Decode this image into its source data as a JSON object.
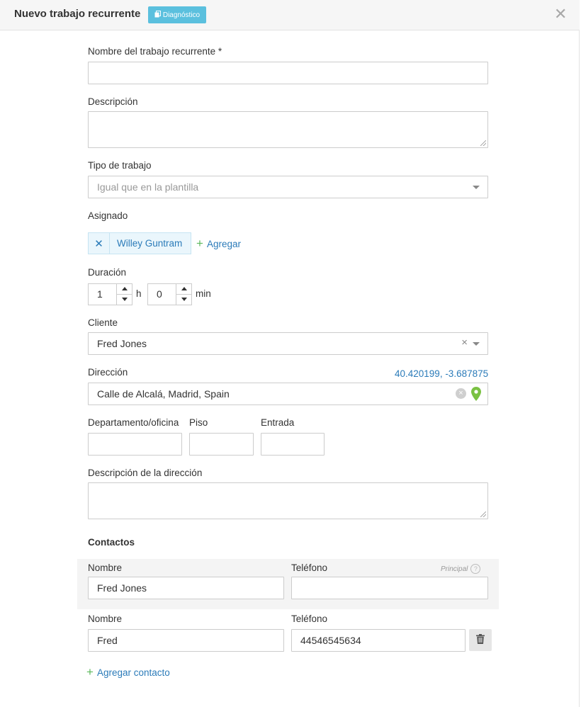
{
  "header": {
    "title": "Nuevo trabajo recurrente",
    "badge": "Diagnóstico",
    "close": "✕"
  },
  "form": {
    "name_label": "Nombre del trabajo recurrente *",
    "name_value": "",
    "description_label": "Descripción",
    "description_value": "",
    "job_type_label": "Tipo de trabajo",
    "job_type_placeholder": "Igual que en la plantilla",
    "assigned_label": "Asignado",
    "assignee_remove": "✕",
    "assignee": "Willey Guntram",
    "add_assignee": "Agregar",
    "add_icon": "+",
    "duration_label": "Duración",
    "duration_hours": "1",
    "hours_unit": "h",
    "duration_minutes": "0",
    "minutes_unit": "min",
    "client_label": "Cliente",
    "client_value": "Fred Jones",
    "client_clear": "×",
    "address_label": "Dirección",
    "coordinates": "40.420199, -3.687875",
    "address_value": "Calle de Alcalá, Madrid, Spain",
    "address_clear": "×",
    "department_label": "Departamento/oficina",
    "floor_label": "Piso",
    "entrance_label": "Entrada",
    "department_value": "",
    "floor_value": "",
    "entrance_value": "",
    "address_description_label": "Descripción de la dirección",
    "address_description_value": ""
  },
  "contacts": {
    "heading": "Contactos",
    "principal_label": "Principal",
    "help_icon": "?",
    "rows": [
      {
        "name_label": "Nombre",
        "phone_label": "Teléfono",
        "name": "Fred Jones",
        "phone": ""
      },
      {
        "name_label": "Nombre",
        "phone_label": "Teléfono",
        "name": "Fred",
        "phone": "44546545634"
      }
    ],
    "add_contact": "Agregar contacto",
    "add_icon": "+"
  },
  "colors": {
    "accent": "#2b7bb9",
    "badge": "#5bc0de",
    "add_green": "#5cb85c",
    "pin_green": "#7ac142"
  }
}
